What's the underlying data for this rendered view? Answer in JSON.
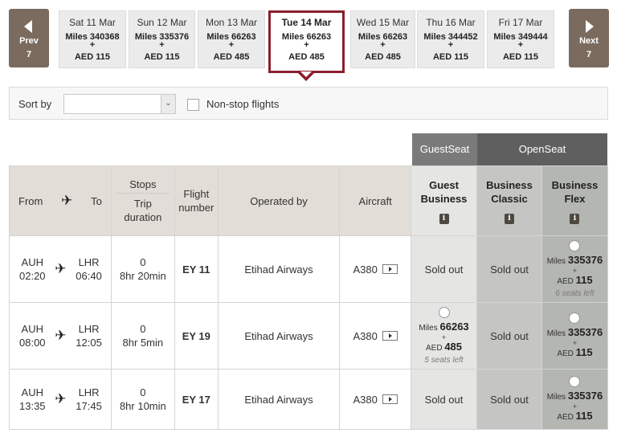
{
  "carousel": {
    "prev": {
      "label": "Prev",
      "count": "7"
    },
    "next": {
      "label": "Next",
      "count": "7"
    },
    "dates": [
      {
        "date": "Sat 11 Mar",
        "miles": "Miles 340368",
        "plus": "+",
        "aed": "AED 115",
        "selected": false
      },
      {
        "date": "Sun 12 Mar",
        "miles": "Miles 335376",
        "plus": "+",
        "aed": "AED 115",
        "selected": false
      },
      {
        "date": "Mon 13 Mar",
        "miles": "Miles 66263",
        "plus": "+",
        "aed": "AED 485",
        "selected": false
      },
      {
        "date": "Tue 14 Mar",
        "miles": "Miles 66263",
        "plus": "+",
        "aed": "AED 485",
        "selected": true
      },
      {
        "date": "Wed 15 Mar",
        "miles": "Miles 66263",
        "plus": "+",
        "aed": "AED 485",
        "selected": false
      },
      {
        "date": "Thu 16 Mar",
        "miles": "Miles 344452",
        "plus": "+",
        "aed": "AED 115",
        "selected": false
      },
      {
        "date": "Fri 17 Mar",
        "miles": "Miles 349444",
        "plus": "+",
        "aed": "AED 115",
        "selected": false
      }
    ]
  },
  "filters": {
    "sort_label": "Sort by",
    "sort_value": "",
    "nonstop_label": "Non-stop flights",
    "nonstop_checked": false
  },
  "categories": {
    "guest": "GuestSeat",
    "open": "OpenSeat"
  },
  "headers": {
    "from": "From",
    "to": "To",
    "stops": "Stops",
    "duration": "Trip duration",
    "flight": "Flight number",
    "operated": "Operated by",
    "aircraft": "Aircraft",
    "fares": [
      {
        "name": "Guest Business",
        "info": "i"
      },
      {
        "name": "Business Classic",
        "info": "i"
      },
      {
        "name": "Business Flex",
        "info": "i"
      }
    ]
  },
  "flights": [
    {
      "from": "AUH",
      "dep": "02:20",
      "to": "LHR",
      "arr": "06:40",
      "stops": "0",
      "duration": "8hr 20min",
      "flight": "EY 11",
      "operator": "Etihad Airways",
      "aircraft": "A380",
      "fares": [
        {
          "status": "Sold out"
        },
        {
          "status": "Sold out"
        },
        {
          "miles_label": "Miles",
          "miles": "335376",
          "plus": "+",
          "aed_label": "AED",
          "aed": "115",
          "seats": "6 seats left"
        }
      ]
    },
    {
      "from": "AUH",
      "dep": "08:00",
      "to": "LHR",
      "arr": "12:05",
      "stops": "0",
      "duration": "8hr 5min",
      "flight": "EY 19",
      "operator": "Etihad Airways",
      "aircraft": "A380",
      "fares": [
        {
          "miles_label": "Miles",
          "miles": "66263",
          "plus": "+",
          "aed_label": "AED",
          "aed": "485",
          "seats": "5 seats left"
        },
        {
          "status": "Sold out"
        },
        {
          "miles_label": "Miles",
          "miles": "335376",
          "plus": "+",
          "aed_label": "AED",
          "aed": "115"
        }
      ]
    },
    {
      "from": "AUH",
      "dep": "13:35",
      "to": "LHR",
      "arr": "17:45",
      "stops": "0",
      "duration": "8hr 10min",
      "flight": "EY 17",
      "operator": "Etihad Airways",
      "aircraft": "A380",
      "fares": [
        {
          "status": "Sold out"
        },
        {
          "status": "Sold out"
        },
        {
          "miles_label": "Miles",
          "miles": "335376",
          "plus": "+",
          "aed_label": "AED",
          "aed": "115"
        }
      ]
    }
  ],
  "colors": {
    "nav_button": "#7b6b5e",
    "selected_border": "#8b1e2d",
    "flight_number": "#7a1e22",
    "guestseat_header": "#7a7a7a",
    "openseat_header": "#5f5f5f"
  }
}
